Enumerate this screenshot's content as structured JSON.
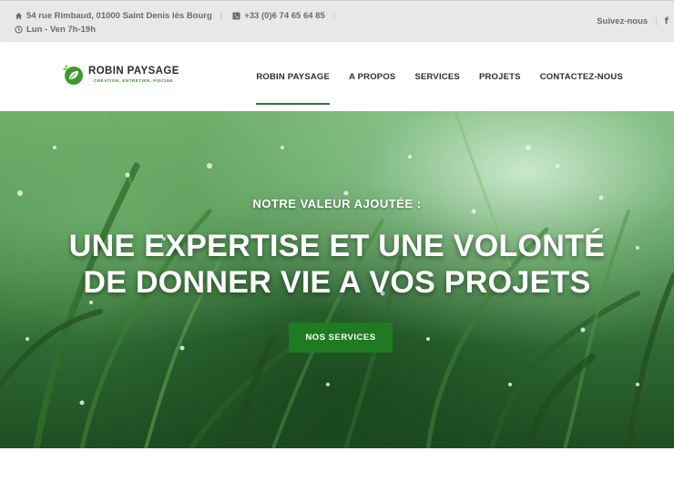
{
  "topbar": {
    "address": "54 rue Rimbaud, 01000 Saint Denis lès Bourg",
    "phone": "+33 (0)6 74 65 64 85",
    "hours": "Lun - Ven 7h-19h",
    "follow": "Suivez-nous",
    "facebook": "f",
    "icons": [
      "home-icon",
      "phone-icon",
      "clock-icon",
      "facebook-icon"
    ]
  },
  "header": {
    "logo_title": "ROBIN PAYSAGE",
    "logo_subtitle": "CRÉATION, ENTRETIEN, PISCINE",
    "nav": [
      {
        "label": "ROBIN PAYSAGE",
        "active": true
      },
      {
        "label": "A PROPOS",
        "active": false
      },
      {
        "label": "SERVICES",
        "active": false
      },
      {
        "label": "PROJETS",
        "active": false
      },
      {
        "label": "CONTACTEZ-NOUS",
        "active": false
      }
    ]
  },
  "hero": {
    "kicker": "NOTRE VALEUR AJOUTÉE :",
    "title_line1": "UNE EXPERTISE ET UNE VOLONTÉ",
    "title_line2": "DE DONNER VIE A VOS PROJETS",
    "button": "NOS SERVICES"
  },
  "colors": {
    "accent": "#2e7d32",
    "button": "#1f7a22",
    "topbar_bg": "#e8e8e8"
  }
}
